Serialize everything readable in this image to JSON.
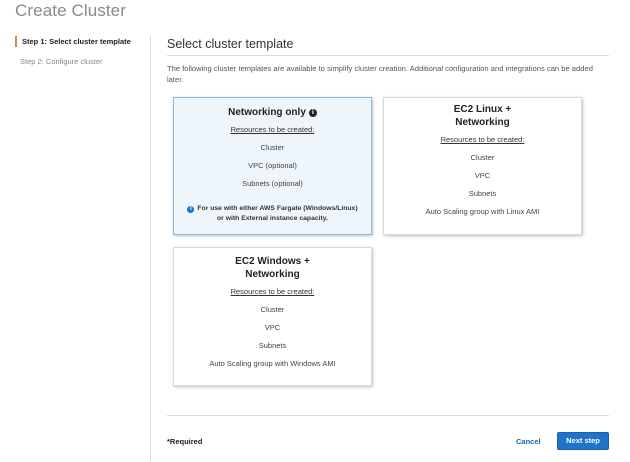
{
  "page": {
    "title": "Create Cluster"
  },
  "steps": [
    {
      "label": "Step 1: Select cluster template"
    },
    {
      "label": "Step 2: Configure cluster"
    }
  ],
  "main": {
    "title": "Select cluster template",
    "intro": "The following cluster templates are available to simplify cluster creation. Additional configuration and integrations can be added later."
  },
  "templates": [
    {
      "title": "Networking only",
      "resources_label": "Resources to be created:",
      "items": [
        "Cluster",
        "VPC (optional)",
        "Subnets (optional)"
      ],
      "note": "For use with either AWS Fargate (Windows/Linux) or with External instance capacity."
    },
    {
      "title_line1": "EC2 Linux +",
      "title_line2": "Networking",
      "resources_label": "Resources to be created:",
      "items": [
        "Cluster",
        "VPC",
        "Subnets",
        "Auto Scaling group with Linux AMI"
      ]
    },
    {
      "title_line1": "EC2 Windows +",
      "title_line2": "Networking",
      "resources_label": "Resources to be created:",
      "items": [
        "Cluster",
        "VPC",
        "Subnets",
        "Auto Scaling group with Windows AMI"
      ]
    }
  ],
  "footer": {
    "required": "*Required",
    "cancel": "Cancel",
    "next": "Next step"
  },
  "colors": {
    "accent": "#1f73c9",
    "step_marker": "#e7862a",
    "selected_bg": "#eef6fc"
  }
}
